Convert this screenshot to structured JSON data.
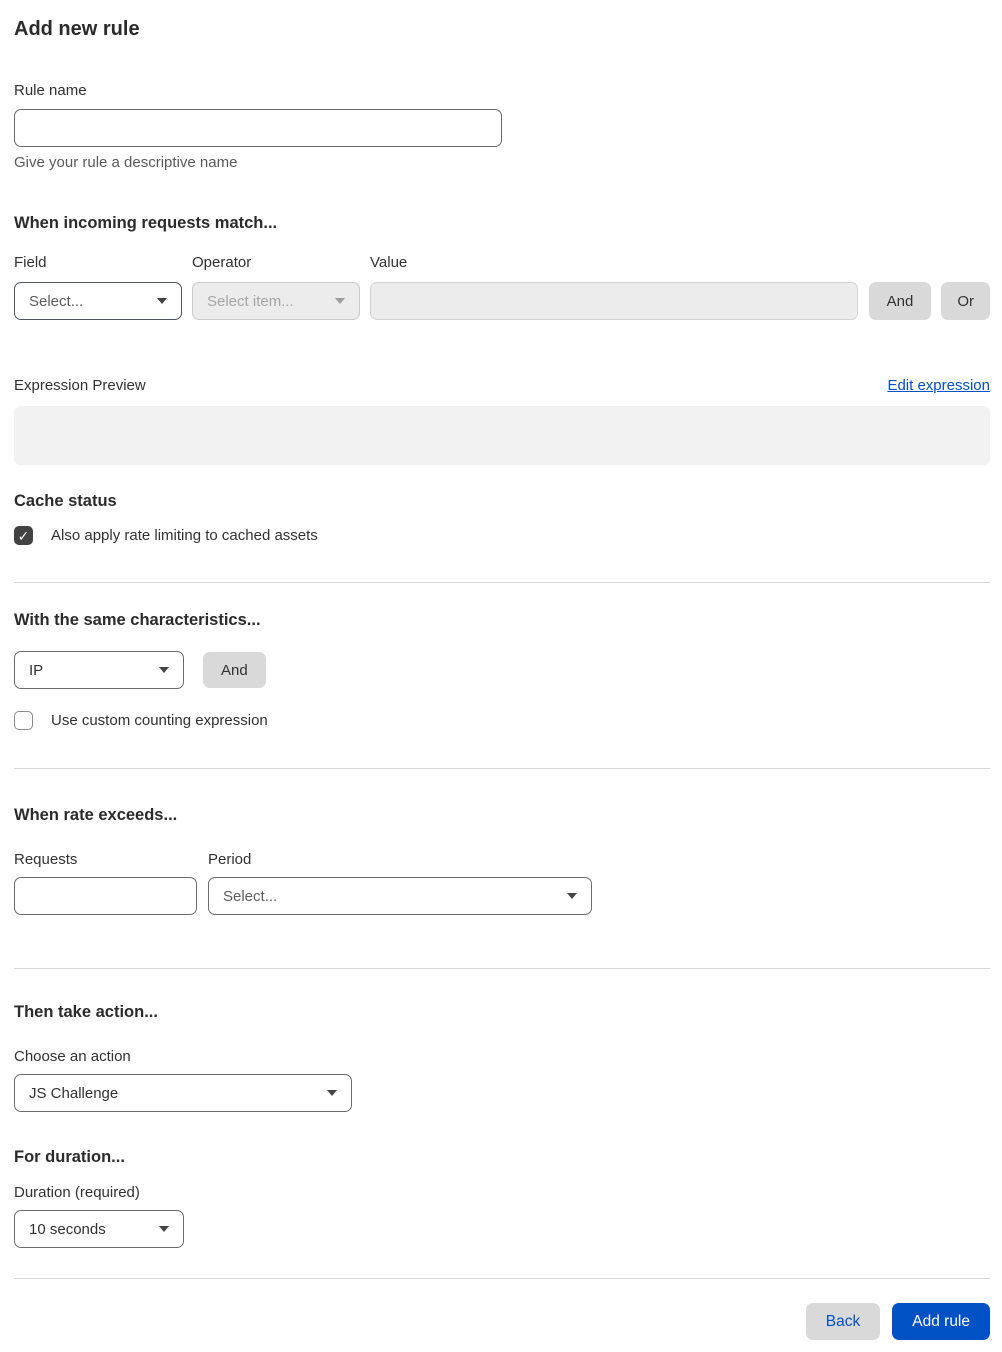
{
  "page": {
    "title": "Add new rule"
  },
  "rule_name": {
    "label": "Rule name",
    "value": "",
    "helper": "Give your rule a descriptive name"
  },
  "match_section": {
    "heading": "When incoming requests match...",
    "field": {
      "label": "Field",
      "placeholder": "Select..."
    },
    "operator": {
      "label": "Operator",
      "placeholder": "Select item..."
    },
    "value": {
      "label": "Value",
      "value": ""
    },
    "and_button": "And",
    "or_button": "Or",
    "expression_preview_label": "Expression Preview",
    "edit_expression_link": "Edit expression",
    "expression_preview_value": ""
  },
  "cache_section": {
    "heading": "Cache status",
    "checkbox_label": "Also apply rate limiting to cached assets",
    "checked": true
  },
  "characteristics_section": {
    "heading": "With the same characteristics...",
    "selected_characteristic": "IP",
    "and_button": "And",
    "checkbox_label": "Use custom counting expression",
    "checked": false
  },
  "rate_section": {
    "heading": "When rate exceeds...",
    "requests": {
      "label": "Requests",
      "value": ""
    },
    "period": {
      "label": "Period",
      "placeholder": "Select..."
    }
  },
  "action_section": {
    "heading": "Then take action...",
    "label": "Choose an action",
    "selected_action": "JS Challenge"
  },
  "duration_section": {
    "heading": "For duration...",
    "label": "Duration (required)",
    "selected_duration": "10 seconds"
  },
  "footer": {
    "back_button": "Back",
    "add_rule_button": "Add rule"
  },
  "colors": {
    "primary_blue": "#0051c3",
    "link_blue": "#0051c3",
    "checkbox_dark": "#424242",
    "disabled_bg": "#ececec",
    "button_gray": "#d9d9d9"
  }
}
